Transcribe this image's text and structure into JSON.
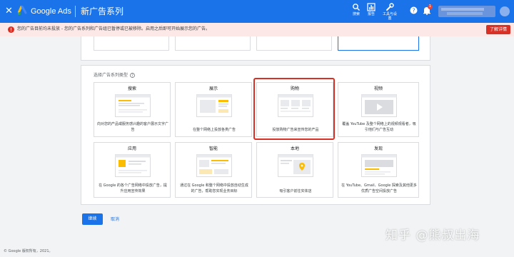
{
  "header": {
    "app_name": "Google Ads",
    "page_title": "新广告系列",
    "search_label": "搜索",
    "reports_label": "报告",
    "tools_label": "工具与设置",
    "notification_count": "1"
  },
  "alert": {
    "message": "您的广告目前均未投放 - 您的广告系列和广告组已暂停或已被移除。启用之后即可开始展示您的广告。",
    "details_label": "了解详情"
  },
  "section": {
    "label": "选择广告系列类型"
  },
  "campaign_types": [
    {
      "name": "搜索",
      "desc": "向对您的产品或服务感兴趣的客户展示文字广告"
    },
    {
      "name": "展示",
      "desc": "在整个网络上投放各类广告"
    },
    {
      "name": "购物",
      "desc": "投放购物广告来宣传您的产品"
    },
    {
      "name": "视频",
      "desc": "覆盖 YouTube 及整个网络上的视频观看者，吸引他们与广告互动"
    },
    {
      "name": "应用",
      "desc": "在 Google 的各个广告网络中投放广告，提升应用宣传效果"
    },
    {
      "name": "智能",
      "desc": "通过在 Google 和整个网络中投放自动生成的广告，帮助您实现业务目标"
    },
    {
      "name": "本地",
      "desc": "吸引客户前往实体店"
    },
    {
      "name": "发现",
      "desc": "在 YouTube、Gmail、Google 探索及其他更多优质广告空间投放广告"
    }
  ],
  "actions": {
    "continue_label": "继续",
    "cancel_label": "取消"
  },
  "footer": {
    "copyright": "© Google 版权所有，2021。"
  },
  "watermark": {
    "text": "知乎 @熊叔出海"
  },
  "colors": {
    "brand_blue": "#1a73e8",
    "alert_bg": "#fce8e6",
    "alert_red": "#d93025",
    "selection_outline": "#d93025"
  }
}
